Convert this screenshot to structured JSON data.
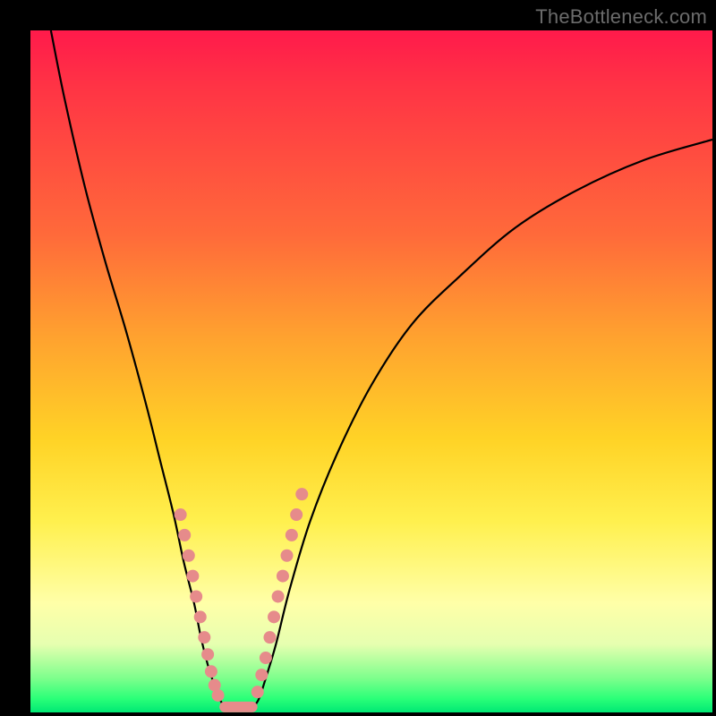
{
  "watermark": "TheBottleneck.com",
  "colors": {
    "gradient_top": "#ff1a4b",
    "gradient_mid": "#ffd326",
    "gradient_bottom": "#00e874",
    "curve": "#000000",
    "dots": "#e68b8b",
    "frame": "#000000"
  },
  "chart_data": {
    "type": "line",
    "title": "",
    "xlabel": "",
    "ylabel": "",
    "xlim": [
      0,
      100
    ],
    "ylim": [
      0,
      100
    ],
    "grid": false,
    "legend": null,
    "series": [
      {
        "name": "left-branch",
        "x": [
          3,
          5,
          8,
          11,
          14,
          17,
          19,
          21,
          22.5,
          24,
          25,
          26,
          26.8,
          27.5,
          28.2,
          29
        ],
        "y": [
          100,
          90,
          77,
          66,
          56,
          45,
          37,
          29,
          22,
          16,
          11,
          7,
          4.5,
          2.5,
          1.2,
          0.5
        ]
      },
      {
        "name": "right-branch",
        "x": [
          32.5,
          33.5,
          34.5,
          36,
          38,
          41,
          45,
          50,
          56,
          63,
          71,
          80,
          90,
          100
        ],
        "y": [
          0.5,
          2,
          5,
          10,
          18,
          28,
          38,
          48,
          57,
          64,
          71,
          76.5,
          81,
          84
        ]
      }
    ],
    "annotations": {
      "left_dots": [
        {
          "x": 22.0,
          "y": 29
        },
        {
          "x": 22.6,
          "y": 26
        },
        {
          "x": 23.2,
          "y": 23
        },
        {
          "x": 23.8,
          "y": 20
        },
        {
          "x": 24.3,
          "y": 17
        },
        {
          "x": 24.9,
          "y": 14
        },
        {
          "x": 25.5,
          "y": 11
        },
        {
          "x": 26.0,
          "y": 8.5
        },
        {
          "x": 26.5,
          "y": 6
        },
        {
          "x": 27.0,
          "y": 4
        },
        {
          "x": 27.5,
          "y": 2.5
        }
      ],
      "right_dots": [
        {
          "x": 33.3,
          "y": 3
        },
        {
          "x": 33.9,
          "y": 5.5
        },
        {
          "x": 34.5,
          "y": 8
        },
        {
          "x": 35.1,
          "y": 11
        },
        {
          "x": 35.7,
          "y": 14
        },
        {
          "x": 36.3,
          "y": 17
        },
        {
          "x": 37.0,
          "y": 20
        },
        {
          "x": 37.6,
          "y": 23
        },
        {
          "x": 38.3,
          "y": 26
        },
        {
          "x": 39.0,
          "y": 29
        },
        {
          "x": 39.8,
          "y": 32
        }
      ],
      "valley_bridge_x": [
        28.5,
        32.5
      ],
      "valley_bridge_y": 0.8
    }
  }
}
